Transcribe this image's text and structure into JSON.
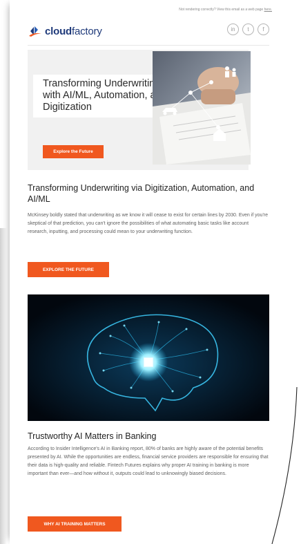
{
  "top_bar": {
    "text": "Not rendering correctly? View this email as a web page",
    "link": "here."
  },
  "brand": {
    "name_bold": "cloud",
    "name_rest": "factory"
  },
  "social": [
    {
      "label": "in",
      "icon": "linkedin-icon"
    },
    {
      "label": "t",
      "icon": "twitter-icon"
    },
    {
      "label": "f",
      "icon": "facebook-icon"
    }
  ],
  "hero": {
    "title": "Transforming Underwriting with AI/ML, Automation, and Digitization",
    "button": "Explore the Future"
  },
  "section1": {
    "heading": "Transforming Underwriting via Digitization, Automation, and AI/ML",
    "body": "McKinsey boldly stated that underwriting as we know it will cease to exist for certain lines by 2030. Even if you're skeptical of that prediction, you can't ignore the possibilities of what automating basic tasks like account research, inputting, and processing could mean to your underwriting function.",
    "button": "EXPLORE THE FUTURE"
  },
  "section2": {
    "heading": "Trustworthy AI Matters in Banking",
    "body": "According to Insider Intelligence's AI in Banking report, 80% of banks are highly aware of the potential benefits presented by AI. While the opportunities are endless, financial service providers are responsible for ensuring that their data is high-quality and reliable. Fintech Futures explains why proper AI training in banking is more important than ever—and how without it, outputs could lead to unknowingly biased decisions.",
    "button": "WHY AI TRAINING MATTERS"
  },
  "colors": {
    "accent": "#f0581f",
    "brand": "#1f3a7a"
  }
}
